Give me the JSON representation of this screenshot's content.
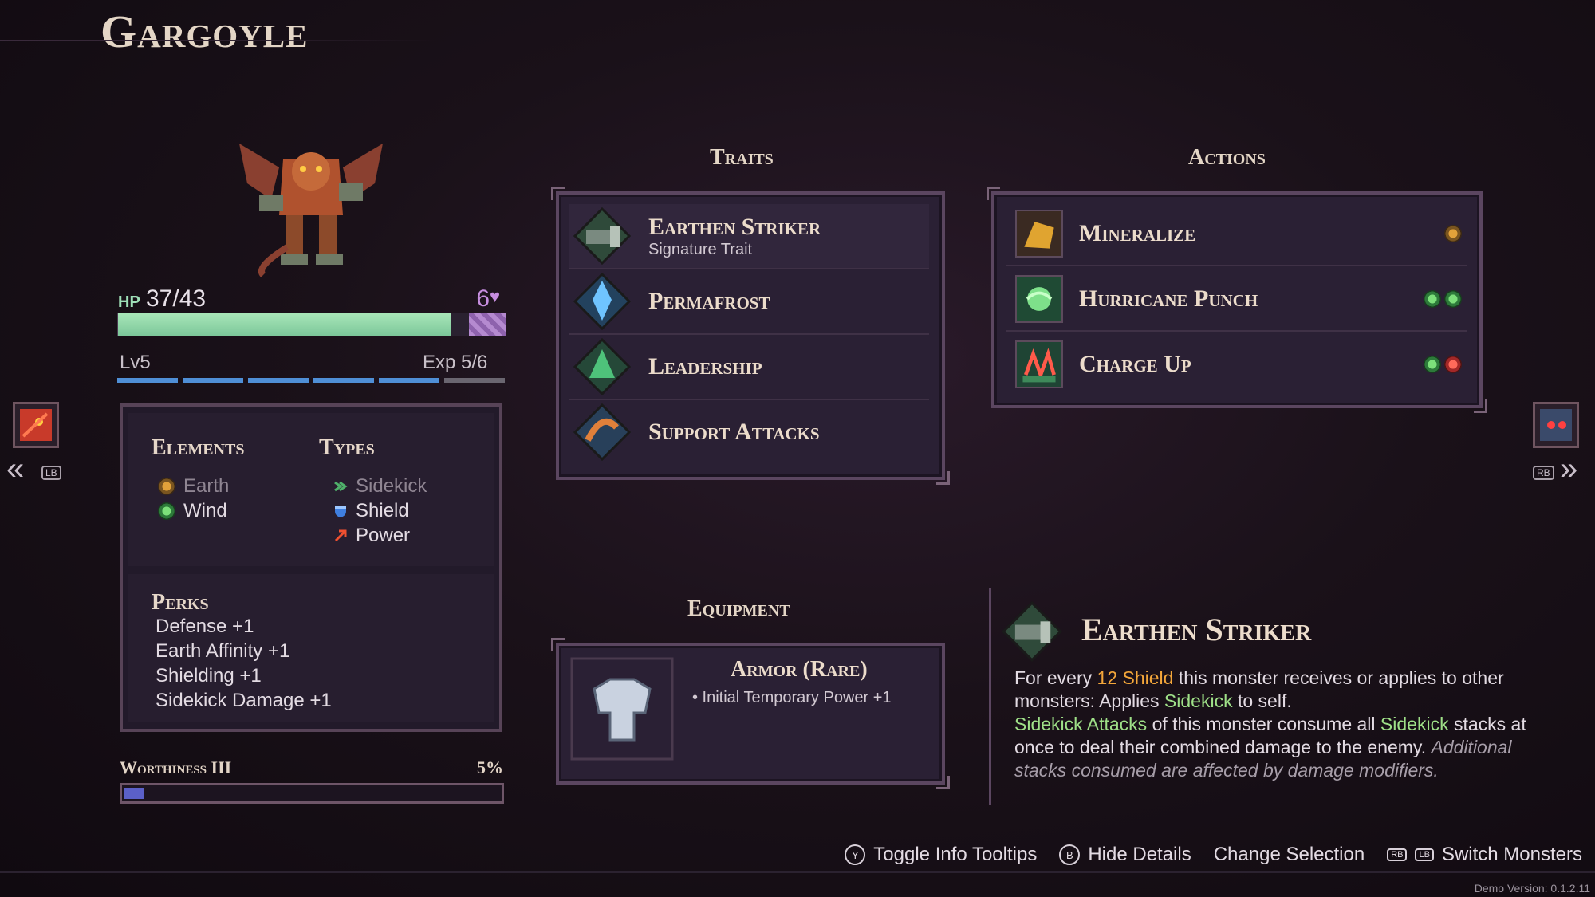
{
  "monster": {
    "name": "Gargoyle",
    "hp_label": "HP",
    "hp_value": "37/43",
    "hp_fraction": 0.86,
    "shield_value": "6",
    "level": "Lv5",
    "exp": "Exp 5/6",
    "exp_segments_filled": 5,
    "exp_segments_total": 6
  },
  "elements": {
    "title": "Elements",
    "items": [
      {
        "label": "Earth",
        "icon": "earth-element-icon",
        "dim": true
      },
      {
        "label": "Wind",
        "icon": "wind-element-icon",
        "dim": false
      }
    ]
  },
  "types": {
    "title": "Types",
    "items": [
      {
        "label": "Sidekick",
        "icon": "sidekick-type-icon",
        "dim": true
      },
      {
        "label": "Shield",
        "icon": "shield-type-icon",
        "dim": false
      },
      {
        "label": "Power",
        "icon": "power-type-icon",
        "dim": false
      }
    ]
  },
  "perks": {
    "title": "Perks",
    "items": [
      "Defense +1",
      "Earth Affinity +1",
      "Shielding +1",
      "Sidekick Damage +1"
    ]
  },
  "worthiness": {
    "label": "Worthiness III",
    "percent_text": "5%",
    "fraction": 0.05
  },
  "nav": {
    "left_button": "LB",
    "right_button": "RB"
  },
  "traits": {
    "title": "Traits",
    "items": [
      {
        "name": "Earthen Striker",
        "sub": "Signature Trait",
        "icon": "earthen-striker-icon"
      },
      {
        "name": "Permafrost",
        "sub": "",
        "icon": "permafrost-icon"
      },
      {
        "name": "Leadership",
        "sub": "",
        "icon": "leadership-icon"
      },
      {
        "name": "Support Attacks",
        "sub": "",
        "icon": "support-attacks-icon"
      }
    ]
  },
  "actions": {
    "title": "Actions",
    "items": [
      {
        "name": "Mineralize",
        "icon": "mineralize-icon",
        "cost": [
          "earth"
        ]
      },
      {
        "name": "Hurricane Punch",
        "icon": "hurricane-punch-icon",
        "cost": [
          "wind",
          "wind"
        ]
      },
      {
        "name": "Charge Up",
        "icon": "charge-up-icon",
        "cost": [
          "wind",
          "fire"
        ]
      }
    ]
  },
  "equipment": {
    "title": "Equipment",
    "name": "Armor (Rare)",
    "desc": "• Initial Temporary Power +1",
    "icon": "armor-icon"
  },
  "detail": {
    "title": "Earthen Striker",
    "p1_a": "For every ",
    "p1_b": "12 Shield",
    "p1_c": " this monster receives or applies to other monsters: Applies ",
    "p1_d": "Sidekick",
    "p1_e": " to self.",
    "p2_a": "Sidekick Attacks",
    "p2_b": " of this monster consume all ",
    "p2_c": "Sidekick",
    "p2_d": " stacks at once to deal their combined damage to the enemy. ",
    "p2_e": "Additional stacks consumed are affected by damage modifiers."
  },
  "footer": {
    "y_btn": "Y",
    "toggle_tooltips": "Toggle Info Tooltips",
    "b_btn": "B",
    "hide_details": "Hide Details",
    "change_selection": "Change Selection",
    "rb_btn": "RB",
    "lb_btn": "LB",
    "switch_monsters": "Switch Monsters",
    "version": "Demo Version: 0.1.2.11"
  },
  "colors": {
    "accent_green": "#9fe088",
    "accent_orange": "#f3a63a",
    "hp_green": "#a8e6b8",
    "exp_blue": "#4f8fd6"
  }
}
